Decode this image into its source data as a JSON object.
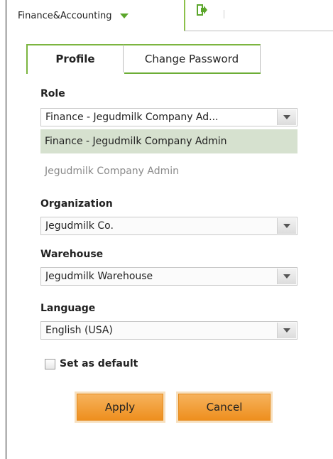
{
  "header": {
    "role_menu_label": "Finance&Accounting"
  },
  "tabs": [
    {
      "label": "Profile"
    },
    {
      "label": "Change Password"
    }
  ],
  "form": {
    "role": {
      "label": "Role",
      "value": "Finance - Jegudmilk Company Ad...",
      "options": [
        "Finance - Jegudmilk Company Admin"
      ],
      "description": "Jegudmilk Company Admin"
    },
    "organization": {
      "label": "Organization",
      "value": "Jegudmilk Co."
    },
    "warehouse": {
      "label": "Warehouse",
      "value": "Jegudmilk Warehouse"
    },
    "language": {
      "label": "Language",
      "value": "English (USA)"
    },
    "default_checkbox": {
      "label": "Set as default",
      "checked": false
    }
  },
  "buttons": {
    "apply": "Apply",
    "cancel": "Cancel"
  },
  "colors": {
    "accent_green": "#7cb540",
    "button_orange": "#ee8f1e",
    "selected_option_bg": "#d6e1cf"
  },
  "icons": {
    "role_menu": "chevron-down-icon",
    "logout": "logout-icon",
    "dropdown": "dropdown-arrow-icon"
  }
}
